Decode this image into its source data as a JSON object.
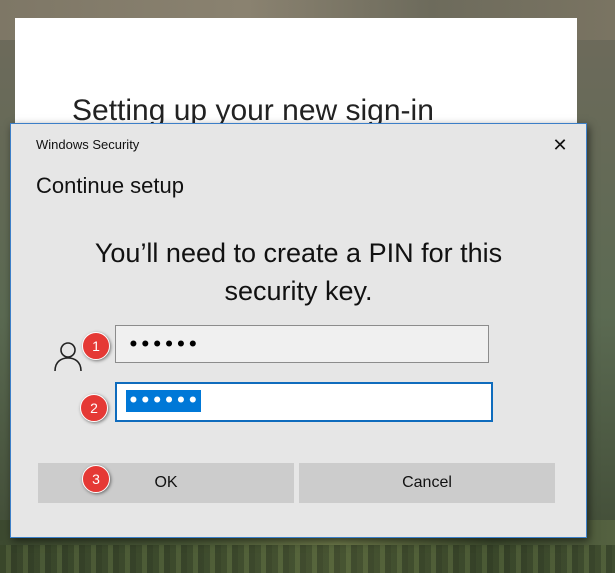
{
  "background_window": {
    "heading": "Setting up your new sign-in"
  },
  "dialog": {
    "window_title": "Windows Security",
    "close_label": "✕",
    "subtitle": "Continue setup",
    "message_line1": "You’ll need to create a PIN for this",
    "message_line2": "security key.",
    "pin_value": "••••••",
    "confirm_pin_value": "••••••",
    "ok_label": "OK",
    "cancel_label": "Cancel"
  },
  "annotations": {
    "step1": "1",
    "step2": "2",
    "step3": "3"
  },
  "colors": {
    "accent": "#0078d7",
    "dialog_bg": "#e6e6e6",
    "button_bg": "#cccccc",
    "badge": "#e53935"
  },
  "icons": {
    "user": "user-icon",
    "close": "close-icon"
  }
}
